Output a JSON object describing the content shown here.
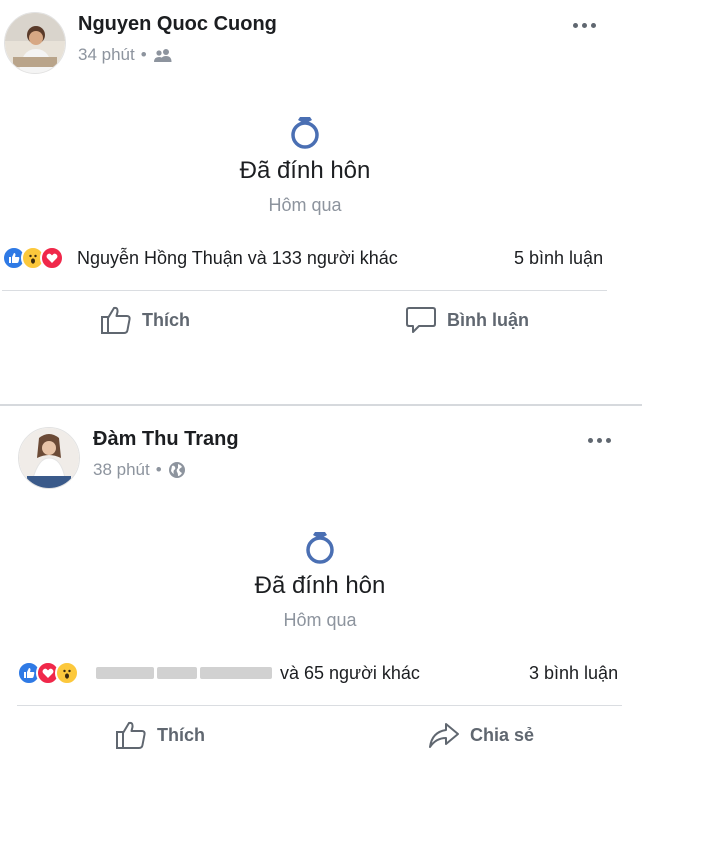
{
  "posts": [
    {
      "author": "Nguyen Quoc Cuong",
      "time": "34 phút",
      "privacy_icon": "friends-icon",
      "event_title": "Đã đính hôn",
      "event_date": "Hôm qua",
      "reactions": [
        "like",
        "wow",
        "love"
      ],
      "reactors_text": "Nguyễn Hồng Thuận và 133 người khác",
      "comments": "5 bình luận",
      "actions": {
        "left": "Thích",
        "right": "Bình luận"
      }
    },
    {
      "author": "Đàm Thu Trang",
      "time": "38 phút",
      "privacy_icon": "globe-icon",
      "event_title": "Đã đính hôn",
      "event_date": "Hôm qua",
      "reactions": [
        "like",
        "love",
        "wow"
      ],
      "reactors_text": "và 65 người khác",
      "comments": "3 bình luận",
      "actions": {
        "left": "Thích",
        "right": "Chia sẻ"
      }
    }
  ],
  "colors": {
    "accent": "#2f7ae5",
    "ring": "#4a6fb3",
    "muted": "#8d949e",
    "action": "#606770"
  }
}
